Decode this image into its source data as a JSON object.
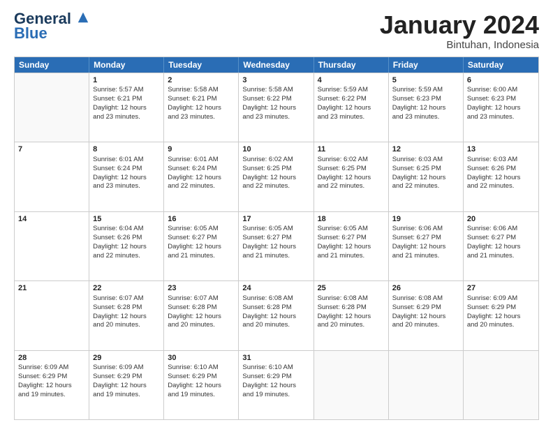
{
  "header": {
    "logo_line1": "General",
    "logo_line2": "Blue",
    "title": "January 2024",
    "subtitle": "Bintuhan, Indonesia"
  },
  "weekdays": [
    "Sunday",
    "Monday",
    "Tuesday",
    "Wednesday",
    "Thursday",
    "Friday",
    "Saturday"
  ],
  "rows": [
    [
      {
        "day": "",
        "info": ""
      },
      {
        "day": "1",
        "info": "Sunrise: 5:57 AM\nSunset: 6:21 PM\nDaylight: 12 hours\nand 23 minutes."
      },
      {
        "day": "2",
        "info": "Sunrise: 5:58 AM\nSunset: 6:21 PM\nDaylight: 12 hours\nand 23 minutes."
      },
      {
        "day": "3",
        "info": "Sunrise: 5:58 AM\nSunset: 6:22 PM\nDaylight: 12 hours\nand 23 minutes."
      },
      {
        "day": "4",
        "info": "Sunrise: 5:59 AM\nSunset: 6:22 PM\nDaylight: 12 hours\nand 23 minutes."
      },
      {
        "day": "5",
        "info": "Sunrise: 5:59 AM\nSunset: 6:23 PM\nDaylight: 12 hours\nand 23 minutes."
      },
      {
        "day": "6",
        "info": "Sunrise: 6:00 AM\nSunset: 6:23 PM\nDaylight: 12 hours\nand 23 minutes."
      }
    ],
    [
      {
        "day": "7",
        "info": ""
      },
      {
        "day": "8",
        "info": "Sunrise: 6:01 AM\nSunset: 6:24 PM\nDaylight: 12 hours\nand 23 minutes."
      },
      {
        "day": "9",
        "info": "Sunrise: 6:01 AM\nSunset: 6:24 PM\nDaylight: 12 hours\nand 22 minutes."
      },
      {
        "day": "10",
        "info": "Sunrise: 6:02 AM\nSunset: 6:25 PM\nDaylight: 12 hours\nand 22 minutes."
      },
      {
        "day": "11",
        "info": "Sunrise: 6:02 AM\nSunset: 6:25 PM\nDaylight: 12 hours\nand 22 minutes."
      },
      {
        "day": "12",
        "info": "Sunrise: 6:03 AM\nSunset: 6:25 PM\nDaylight: 12 hours\nand 22 minutes."
      },
      {
        "day": "13",
        "info": "Sunrise: 6:03 AM\nSunset: 6:26 PM\nDaylight: 12 hours\nand 22 minutes."
      }
    ],
    [
      {
        "day": "14",
        "info": ""
      },
      {
        "day": "15",
        "info": "Sunrise: 6:04 AM\nSunset: 6:26 PM\nDaylight: 12 hours\nand 22 minutes."
      },
      {
        "day": "16",
        "info": "Sunrise: 6:05 AM\nSunset: 6:27 PM\nDaylight: 12 hours\nand 21 minutes."
      },
      {
        "day": "17",
        "info": "Sunrise: 6:05 AM\nSunset: 6:27 PM\nDaylight: 12 hours\nand 21 minutes."
      },
      {
        "day": "18",
        "info": "Sunrise: 6:05 AM\nSunset: 6:27 PM\nDaylight: 12 hours\nand 21 minutes."
      },
      {
        "day": "19",
        "info": "Sunrise: 6:06 AM\nSunset: 6:27 PM\nDaylight: 12 hours\nand 21 minutes."
      },
      {
        "day": "20",
        "info": "Sunrise: 6:06 AM\nSunset: 6:27 PM\nDaylight: 12 hours\nand 21 minutes."
      }
    ],
    [
      {
        "day": "21",
        "info": ""
      },
      {
        "day": "22",
        "info": "Sunrise: 6:07 AM\nSunset: 6:28 PM\nDaylight: 12 hours\nand 20 minutes."
      },
      {
        "day": "23",
        "info": "Sunrise: 6:07 AM\nSunset: 6:28 PM\nDaylight: 12 hours\nand 20 minutes."
      },
      {
        "day": "24",
        "info": "Sunrise: 6:08 AM\nSunset: 6:28 PM\nDaylight: 12 hours\nand 20 minutes."
      },
      {
        "day": "25",
        "info": "Sunrise: 6:08 AM\nSunset: 6:28 PM\nDaylight: 12 hours\nand 20 minutes."
      },
      {
        "day": "26",
        "info": "Sunrise: 6:08 AM\nSunset: 6:29 PM\nDaylight: 12 hours\nand 20 minutes."
      },
      {
        "day": "27",
        "info": "Sunrise: 6:09 AM\nSunset: 6:29 PM\nDaylight: 12 hours\nand 20 minutes."
      }
    ],
    [
      {
        "day": "28",
        "info": "Sunrise: 6:09 AM\nSunset: 6:29 PM\nDaylight: 12 hours\nand 19 minutes."
      },
      {
        "day": "29",
        "info": "Sunrise: 6:09 AM\nSunset: 6:29 PM\nDaylight: 12 hours\nand 19 minutes."
      },
      {
        "day": "30",
        "info": "Sunrise: 6:10 AM\nSunset: 6:29 PM\nDaylight: 12 hours\nand 19 minutes."
      },
      {
        "day": "31",
        "info": "Sunrise: 6:10 AM\nSunset: 6:29 PM\nDaylight: 12 hours\nand 19 minutes."
      },
      {
        "day": "",
        "info": ""
      },
      {
        "day": "",
        "info": ""
      },
      {
        "day": "",
        "info": ""
      }
    ]
  ]
}
